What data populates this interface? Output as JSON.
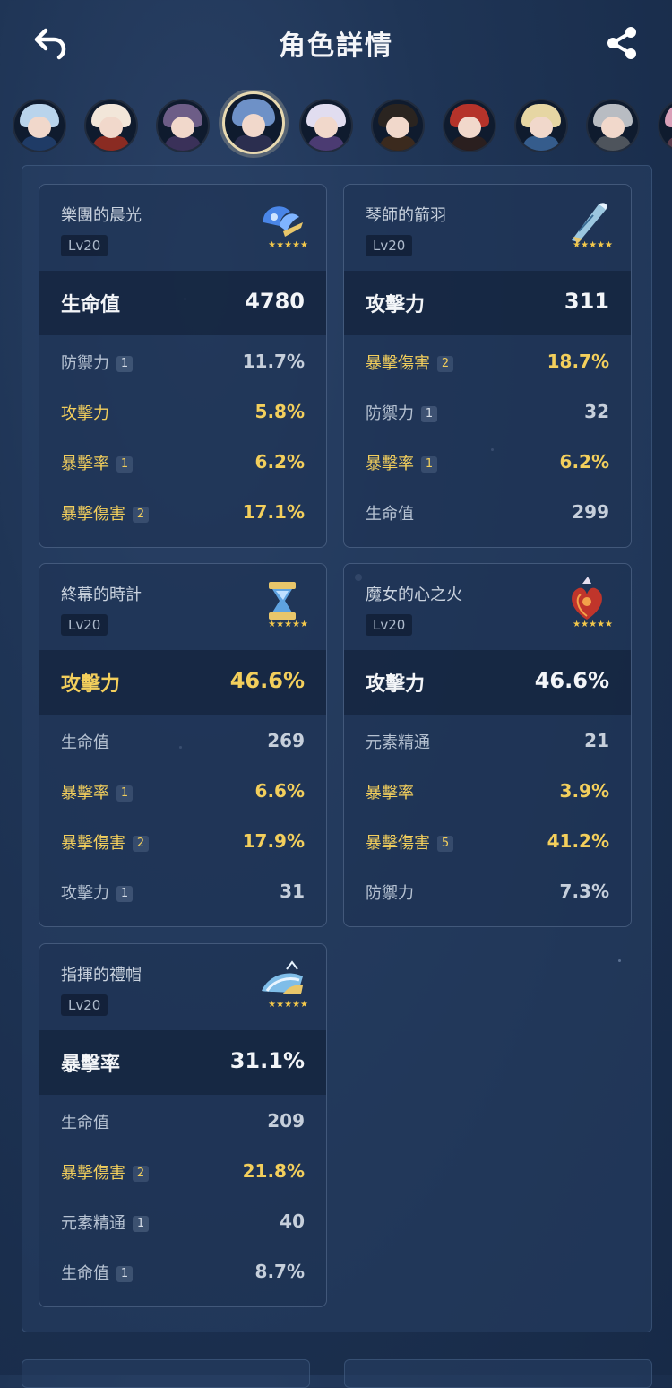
{
  "header": {
    "title": "角色詳情"
  },
  "avatars": [
    {
      "name": "character-1",
      "hair": "#b9d4ec",
      "body": "#1f3b66"
    },
    {
      "name": "character-2",
      "hair": "#f2e6d9",
      "body": "#8a2b22"
    },
    {
      "name": "character-3",
      "hair": "#6d5d87",
      "body": "#3a3159"
    },
    {
      "name": "character-4",
      "hair": "#6e91c7",
      "body": "#2b2e4f",
      "active": true
    },
    {
      "name": "character-5",
      "hair": "#e1ddf0",
      "body": "#4b3b72"
    },
    {
      "name": "character-6",
      "hair": "#2a2420",
      "body": "#3b2a1e"
    },
    {
      "name": "character-7",
      "hair": "#b5332a",
      "body": "#2a1f1f"
    },
    {
      "name": "character-8",
      "hair": "#e6d6a3",
      "body": "#355c8c"
    },
    {
      "name": "character-9",
      "hair": "#b8bcc2",
      "body": "#4e545c"
    },
    {
      "name": "character-10",
      "hair": "#d9a0b8",
      "body": "#5a3a4a"
    }
  ],
  "artifacts": [
    {
      "name": "樂團的晨光",
      "level": "Lv20",
      "stars": "★★★★★",
      "main": {
        "label": "生命值",
        "value": "4780",
        "gold": false
      },
      "subs": [
        {
          "label": "防禦力",
          "badge": "1",
          "value": "11.7%",
          "gold": false
        },
        {
          "label": "攻擊力",
          "badge": "",
          "value": "5.8%",
          "gold": true
        },
        {
          "label": "暴擊率",
          "badge": "1",
          "value": "6.2%",
          "gold": true
        },
        {
          "label": "暴擊傷害",
          "badge": "2",
          "value": "17.1%",
          "gold": true
        }
      ]
    },
    {
      "name": "琴師的箭羽",
      "level": "Lv20",
      "stars": "★★★★★",
      "main": {
        "label": "攻擊力",
        "value": "311",
        "gold": false
      },
      "subs": [
        {
          "label": "暴擊傷害",
          "badge": "2",
          "value": "18.7%",
          "gold": true
        },
        {
          "label": "防禦力",
          "badge": "1",
          "value": "32",
          "gold": false
        },
        {
          "label": "暴擊率",
          "badge": "1",
          "value": "6.2%",
          "gold": true
        },
        {
          "label": "生命值",
          "badge": "",
          "value": "299",
          "gold": false
        }
      ]
    },
    {
      "name": "終幕的時計",
      "level": "Lv20",
      "stars": "★★★★★",
      "main": {
        "label": "攻擊力",
        "value": "46.6%",
        "gold": true
      },
      "subs": [
        {
          "label": "生命值",
          "badge": "",
          "value": "269",
          "gold": false
        },
        {
          "label": "暴擊率",
          "badge": "1",
          "value": "6.6%",
          "gold": true
        },
        {
          "label": "暴擊傷害",
          "badge": "2",
          "value": "17.9%",
          "gold": true
        },
        {
          "label": "攻擊力",
          "badge": "1",
          "value": "31",
          "gold": false
        }
      ]
    },
    {
      "name": "魔女的心之火",
      "level": "Lv20",
      "stars": "★★★★★",
      "main": {
        "label": "攻擊力",
        "value": "46.6%",
        "gold": false
      },
      "subs": [
        {
          "label": "元素精通",
          "badge": "",
          "value": "21",
          "gold": false
        },
        {
          "label": "暴擊率",
          "badge": "",
          "value": "3.9%",
          "gold": true
        },
        {
          "label": "暴擊傷害",
          "badge": "5",
          "value": "41.2%",
          "gold": true
        },
        {
          "label": "防禦力",
          "badge": "",
          "value": "7.3%",
          "gold": false
        }
      ]
    },
    {
      "name": "指揮的禮帽",
      "level": "Lv20",
      "stars": "★★★★★",
      "main": {
        "label": "暴擊率",
        "value": "31.1%",
        "gold": false
      },
      "subs": [
        {
          "label": "生命值",
          "badge": "",
          "value": "209",
          "gold": false
        },
        {
          "label": "暴擊傷害",
          "badge": "2",
          "value": "21.8%",
          "gold": true
        },
        {
          "label": "元素精通",
          "badge": "1",
          "value": "40",
          "gold": false
        },
        {
          "label": "生命值",
          "badge": "1",
          "value": "8.7%",
          "gold": false
        }
      ]
    }
  ]
}
